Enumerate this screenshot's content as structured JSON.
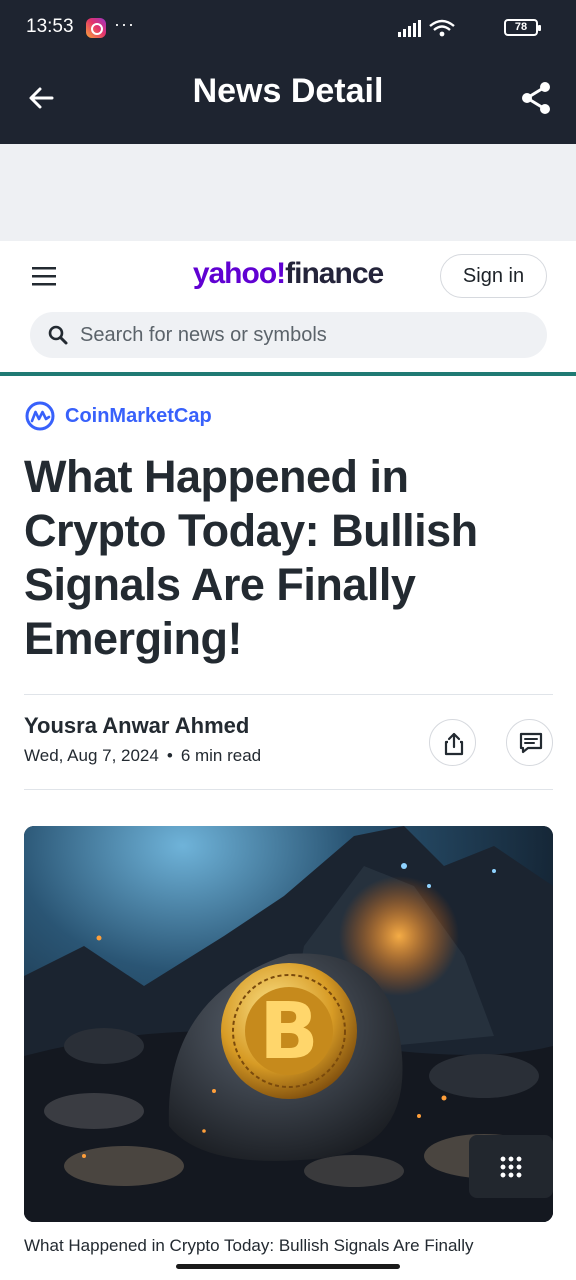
{
  "status_bar": {
    "time": "13:53",
    "more": "···",
    "battery": "78"
  },
  "app_bar": {
    "title": "News Detail"
  },
  "site": {
    "logo_brand": "yahoo!",
    "logo_section": "finance",
    "sign_in_label": "Sign in",
    "search_placeholder": "Search for news or symbols"
  },
  "article": {
    "source": "CoinMarketCap",
    "headline": "What Happened in Crypto Today: Bullish Signals Are Finally Emerging!",
    "author": "Yousra Anwar Ahmed",
    "date": "Wed, Aug 7, 2024",
    "read_time": "6 min read",
    "image_caption": "What Happened in Crypto Today: Bullish Signals Are Finally"
  },
  "colors": {
    "topbar": "#1e2430",
    "yahoo_purple": "#6001d2",
    "cmc_blue": "#3861fb",
    "divider_teal": "#1f7a73"
  },
  "icons": [
    "back-arrow-icon",
    "share-icon",
    "menu-icon",
    "search-icon",
    "share-upload-icon",
    "comment-icon",
    "grid-icon",
    "bitcoin-icon"
  ]
}
